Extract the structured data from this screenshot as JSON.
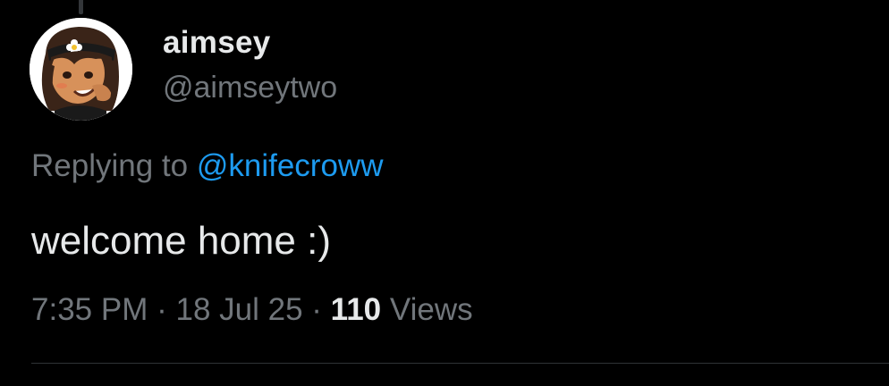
{
  "author": {
    "display_name": "aimsey",
    "handle": "@aimseytwo",
    "avatar_icon": "cartoon-avatar-with-flower-headband"
  },
  "reply": {
    "prefix": "Replying to",
    "mention": "@knifecroww"
  },
  "tweet": {
    "text": "welcome home :)"
  },
  "meta": {
    "time": "7:35 PM",
    "separator": "·",
    "date": "18 Jul 25",
    "views_count": "110",
    "views_label": "Views"
  },
  "colors": {
    "background": "#000000",
    "primary_text": "#e7e9ea",
    "secondary_text": "#71767b",
    "link": "#1d9bf0",
    "divider": "#2f3336"
  }
}
